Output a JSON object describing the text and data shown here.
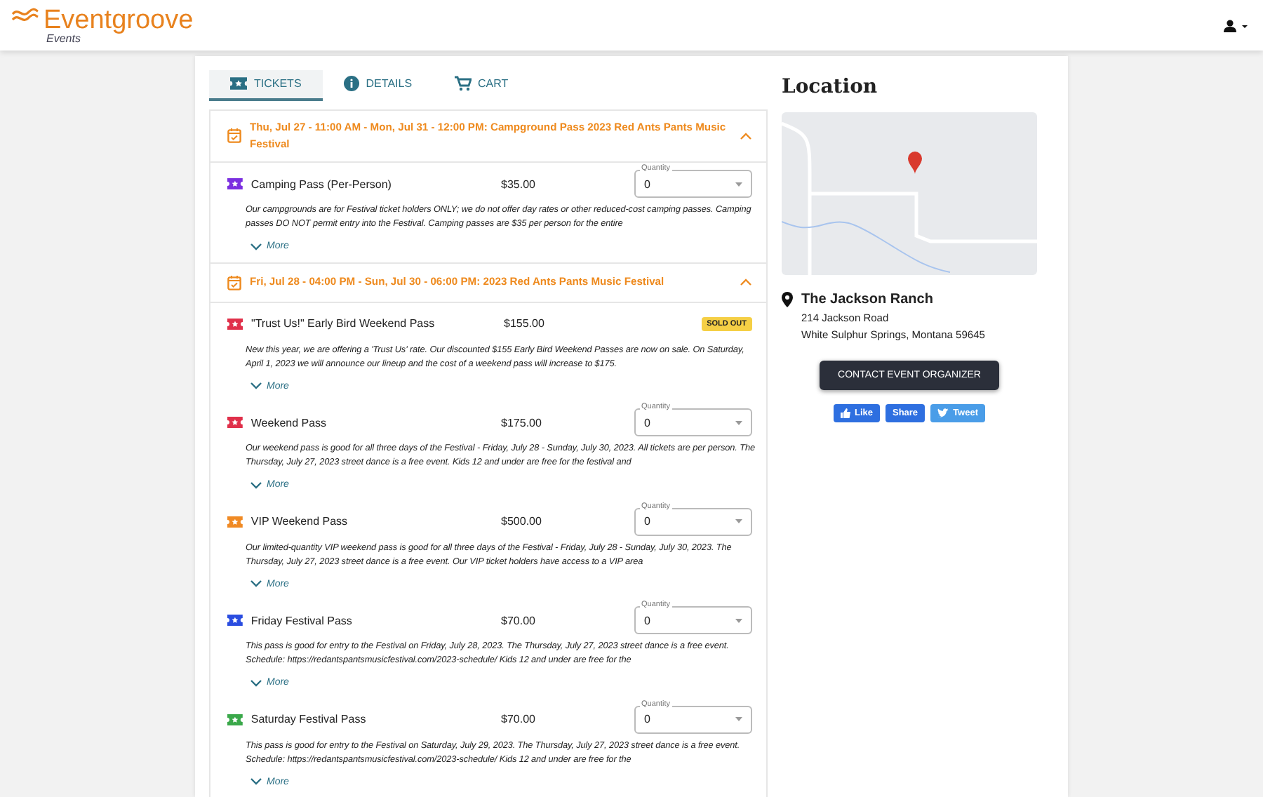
{
  "header": {
    "brand": "Eventgroove",
    "subbrand": "Events"
  },
  "tabs": [
    {
      "label": "TICKETS",
      "kind": "ticket",
      "selected": true
    },
    {
      "label": "DETAILS",
      "kind": "info",
      "selected": false
    },
    {
      "label": "CART",
      "kind": "cart",
      "selected": false
    }
  ],
  "sections": [
    {
      "title": "Thu, Jul 27 - 11:00 AM - Mon, Jul 31 - 12:00 PM: Campground Pass 2023 Red Ants Pants Music Festival",
      "expanded": true,
      "tickets": [
        {
          "name": "Camping Pass (Per-Person)",
          "price": "$35.00",
          "color": "#7b2fe0",
          "kind": "select",
          "quantity_label": "Quantity",
          "quantity": "0",
          "description": "Our campgrounds are for Festival ticket holders ONLY; we do not offer day rates or other reduced-cost camping passes. Camping passes DO NOT permit entry into the Festival. Camping passes are $35 per person for the entire",
          "more": "More"
        }
      ]
    },
    {
      "title": "Fri, Jul 28 - 04:00 PM - Sun, Jul 30 - 06:00 PM: 2023 Red Ants Pants Music Festival",
      "expanded": true,
      "tickets": [
        {
          "name": "\"Trust Us!\" Early Bird Weekend Pass",
          "price": "$155.00",
          "color": "#e0304a",
          "kind": "soldout",
          "badge": "SOLD OUT",
          "description": "New this year, we are offering a 'Trust Us' rate. Our discounted $155 Early Bird Weekend Passes are now on sale. On Saturday, April 1, 2023 we will announce our lineup and the cost of a weekend pass will increase to $175.",
          "more": "More"
        },
        {
          "name": "Weekend Pass",
          "price": "$175.00",
          "color": "#e0304a",
          "kind": "select",
          "quantity_label": "Quantity",
          "quantity": "0",
          "description": "Our weekend pass is good for all three days of the Festival - Friday, July 28 - Sunday, July 30, 2023. All tickets are per person. The Thursday, July 27, 2023 street dance is a free event. Kids 12 and under are free for the festival and",
          "more": "More"
        },
        {
          "name": "VIP Weekend Pass",
          "price": "$500.00",
          "color": "#f08a24",
          "kind": "select",
          "quantity_label": "Quantity",
          "quantity": "0",
          "description": "Our limited-quantity VIP weekend pass is good for all three days of the Festival - Friday, July 28 - Sunday, July 30, 2023. The Thursday, July 27, 2023 street dance is a free event. Our VIP ticket holders have access to a VIP area",
          "more": "More"
        },
        {
          "name": "Friday Festival Pass",
          "price": "$70.00",
          "color": "#2a4de0",
          "kind": "select",
          "quantity_label": "Quantity",
          "quantity": "0",
          "description": "This pass is good for entry to the Festival on Friday, July 28, 2023. The Thursday, July 27, 2023 street dance is a free event. Schedule: https://redantspantsmusicfestival.com/2023-schedule/ Kids 12 and under are free for the",
          "more": "More"
        },
        {
          "name": "Saturday Festival Pass",
          "price": "$70.00",
          "color": "#3aa84a",
          "kind": "select",
          "quantity_label": "Quantity",
          "quantity": "0",
          "description": "This pass is good for entry to the Festival on Saturday, July 29, 2023. The Thursday, July 27, 2023 street dance is a free event. Schedule: https://redantspantsmusicfestival.com/2023-schedule/ Kids 12 and under are free for the",
          "more": "More"
        }
      ]
    }
  ],
  "location": {
    "heading": "Location",
    "venue": "The Jackson Ranch",
    "address_line_1": "214 Jackson Road",
    "address_line_2": "White Sulphur Springs, Montana 59645",
    "contact_button": "CONTACT EVENT ORGANIZER",
    "social": [
      {
        "label": "Like",
        "kind": "like"
      },
      {
        "label": "Share",
        "kind": "share"
      },
      {
        "label": "Tweet",
        "kind": "tweet"
      }
    ]
  }
}
